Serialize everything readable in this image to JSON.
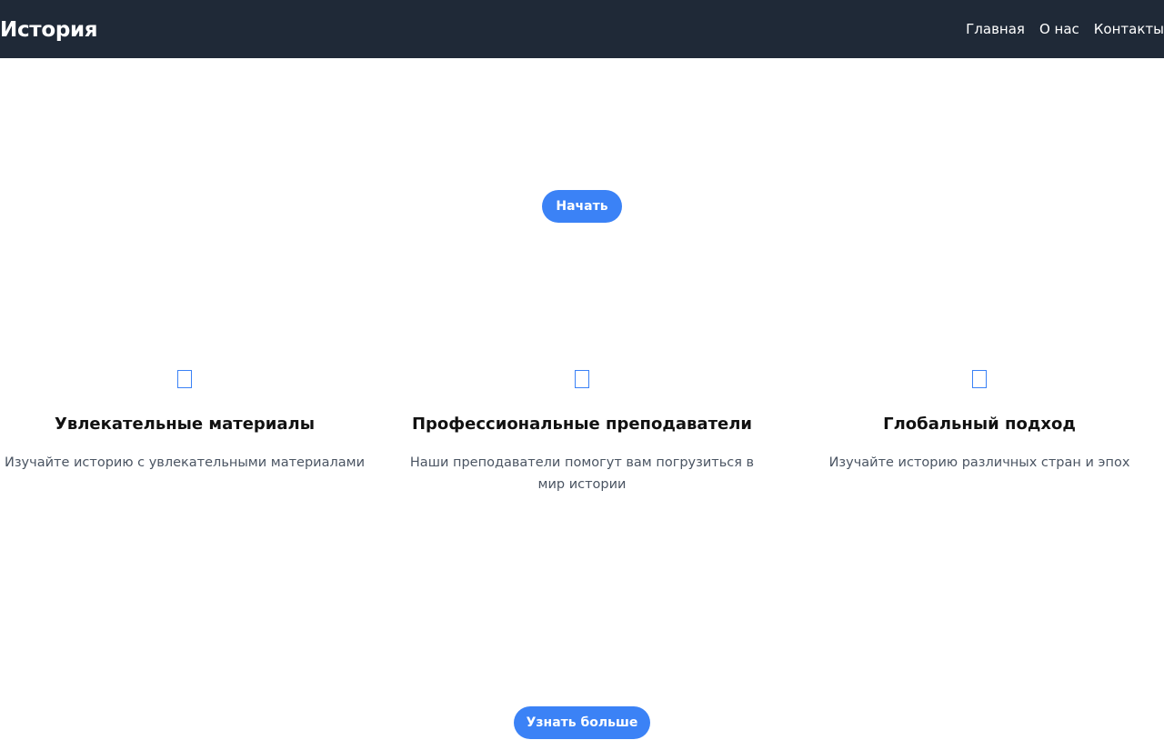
{
  "header": {
    "brand": "История",
    "nav": [
      "Главная",
      "О нас",
      "Контакты"
    ]
  },
  "hero": {
    "button_label": "Начать"
  },
  "features": [
    {
      "icon": "square-icon",
      "title": "Увлекательные материалы",
      "text": "Изучайте историю с увлекательными материалами"
    },
    {
      "icon": "square-icon",
      "title": "Профессиональные преподаватели",
      "text": "Наши преподаватели помогут вам погрузиться в мир истории"
    },
    {
      "icon": "square-icon",
      "title": "Глобальный подход",
      "text": "Изучайте историю различных стран и эпох"
    }
  ],
  "cta": {
    "button_label": "Узнать больше"
  },
  "colors": {
    "header_bg": "#1f2937",
    "accent": "#3b82f6"
  }
}
